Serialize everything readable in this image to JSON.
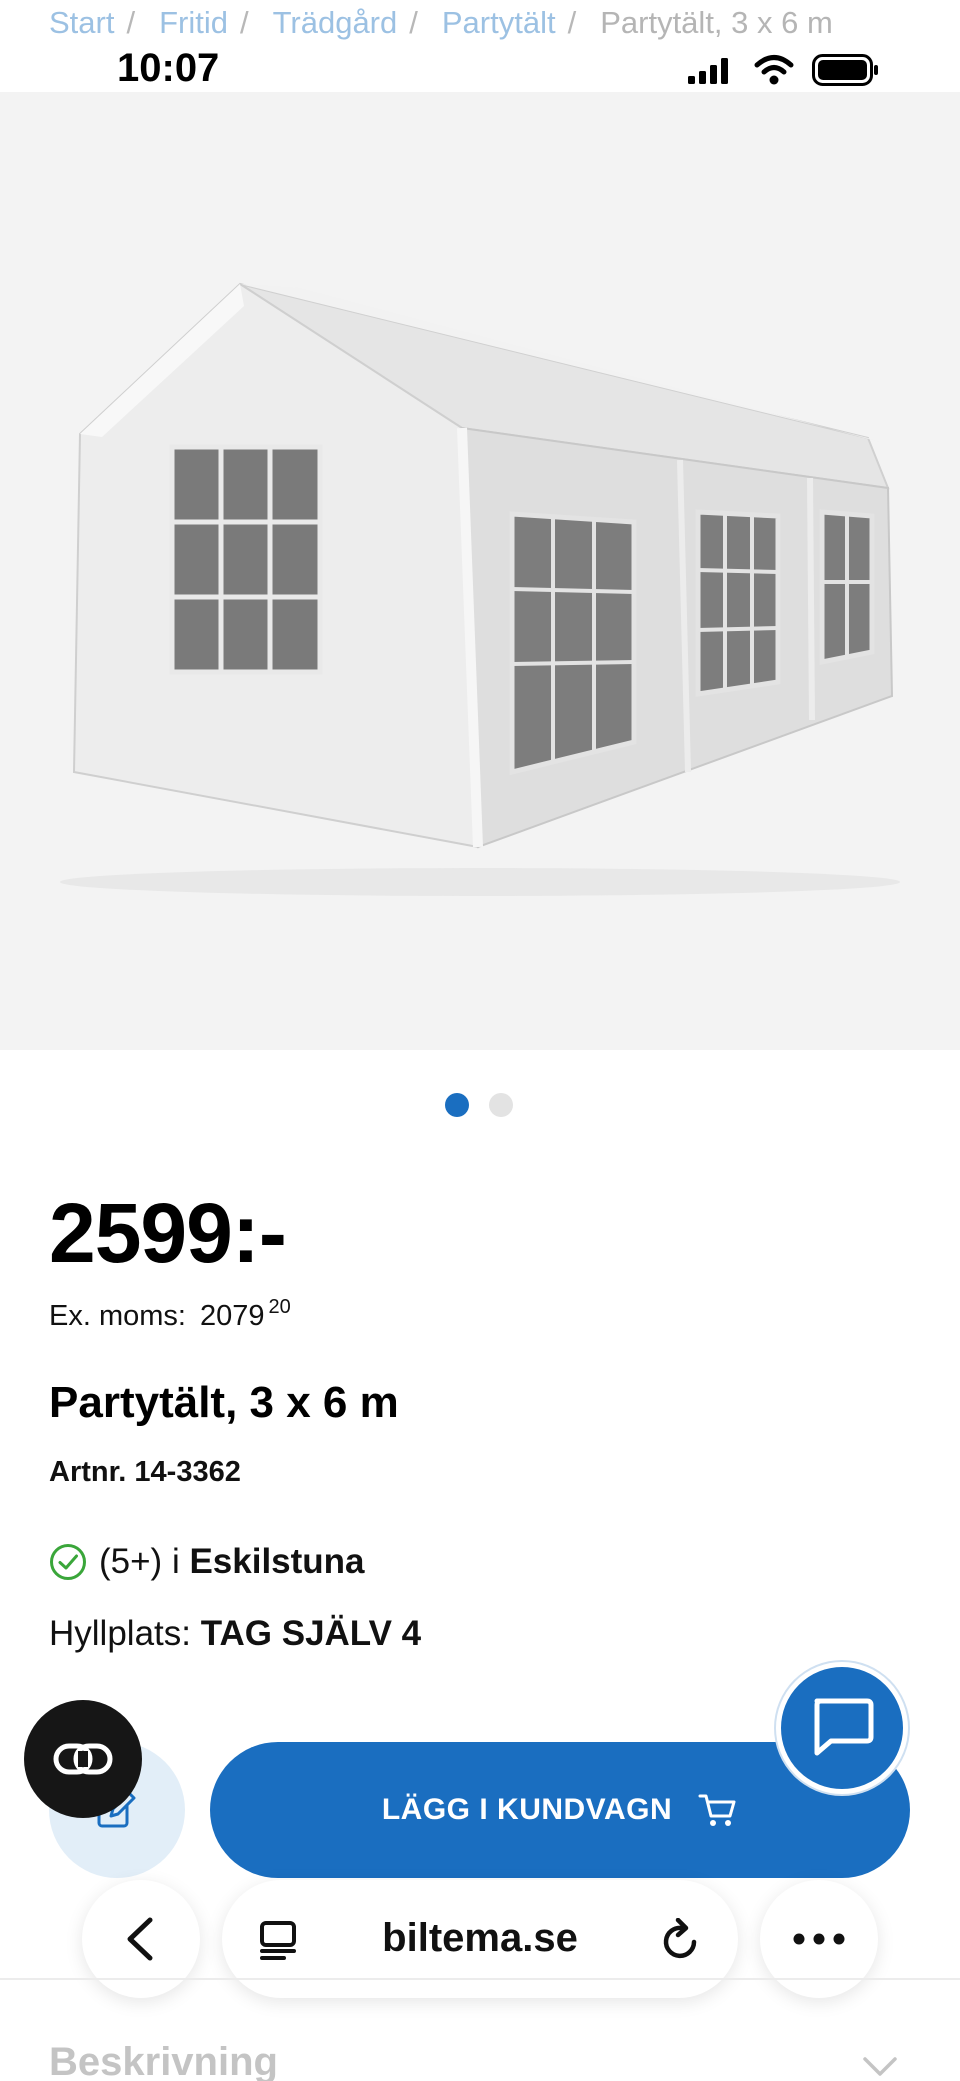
{
  "breadcrumb": {
    "items": [
      {
        "label": "Start"
      },
      {
        "label": "Fritid"
      },
      {
        "label": "Trädgård"
      },
      {
        "label": "Partytält"
      }
    ],
    "separator": "/",
    "current": "Partytält, 3 x 6 m"
  },
  "status_bar": {
    "time": "10:07",
    "icons": [
      "signal-icon",
      "wifi-icon",
      "battery-icon"
    ]
  },
  "gallery": {
    "image_alt": "Partytält, 3 x 6 m",
    "page_count": 2,
    "active_index": 0
  },
  "product": {
    "price": "2599:-",
    "ex_moms_label": "Ex. moms:",
    "ex_moms_whole": "2079",
    "ex_moms_decimals": "20",
    "title": "Partytält, 3 x 6 m",
    "artnr": "Artnr. 14-3362",
    "stock_count": "(5+) i",
    "stock_store": "Eskilstuna",
    "shelf_label": "Hyllplats:",
    "shelf_value": "TAG SJÄLV 4"
  },
  "actions": {
    "add_to_cart_label": "LÄGG I KUNDVAGN",
    "icons": [
      "edit-icon",
      "cart-icon",
      "chat-icon",
      "link-icon"
    ]
  },
  "browser": {
    "url": "biltema.se",
    "icons": [
      "back-icon",
      "reader-icon",
      "reload-icon",
      "more-icon"
    ]
  },
  "sections": {
    "description_heading": "Beskrivning"
  },
  "colors": {
    "accent": "#1a6ec0",
    "breadcrumb_link": "#9cc1e3",
    "in_stock": "#3aa63a"
  }
}
